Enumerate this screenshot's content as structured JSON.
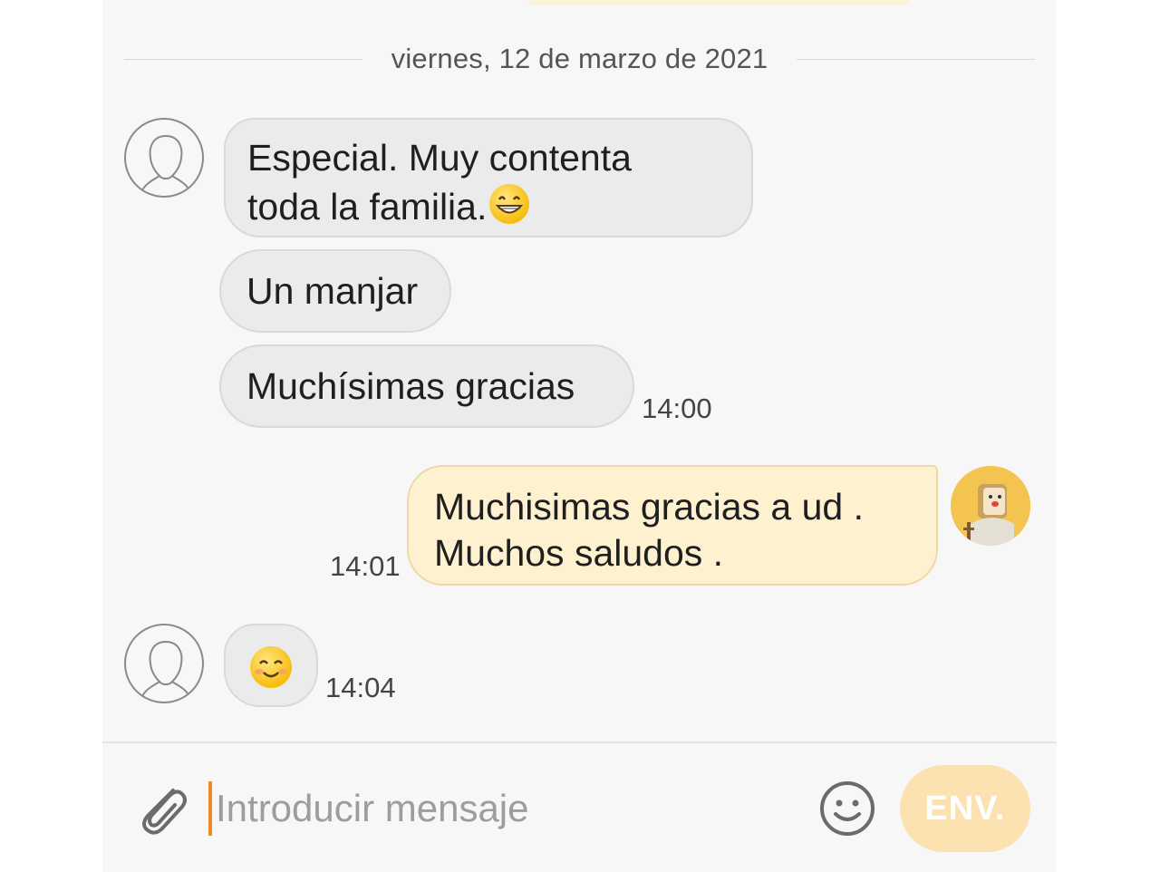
{
  "conversation": {
    "date_separator": "viernes, 12 de marzo de 2021",
    "messages": [
      {
        "direction": "incoming",
        "lines": [
          "Especial. Muy contenta",
          "toda la familia."
        ],
        "emoji": "grinning-face-with-smiling-eyes"
      },
      {
        "direction": "incoming",
        "text": "Un manjar"
      },
      {
        "direction": "incoming",
        "text": "Muchísimas gracias",
        "time": "14:00"
      },
      {
        "direction": "outgoing",
        "lines": [
          "Muchisimas gracias a ud .",
          "Muchos saludos ."
        ],
        "time": "14:01"
      },
      {
        "direction": "incoming",
        "emoji": "smiling-face-with-smiling-eyes",
        "time": "14:04"
      }
    ]
  },
  "composer": {
    "placeholder": "Introducir mensaje",
    "value": "",
    "send_label": "ENV."
  },
  "icons": {
    "attach": "paperclip-icon",
    "emoji": "smiley-icon",
    "contact_avatar": "default-person-avatar",
    "self_avatar": "cartoon-character-avatar"
  },
  "colors": {
    "incoming_bubble": "#ebebeb",
    "outgoing_bubble": "#fdf1cf",
    "send_button": "#fbe2b0",
    "cursor": "#f08a24"
  }
}
